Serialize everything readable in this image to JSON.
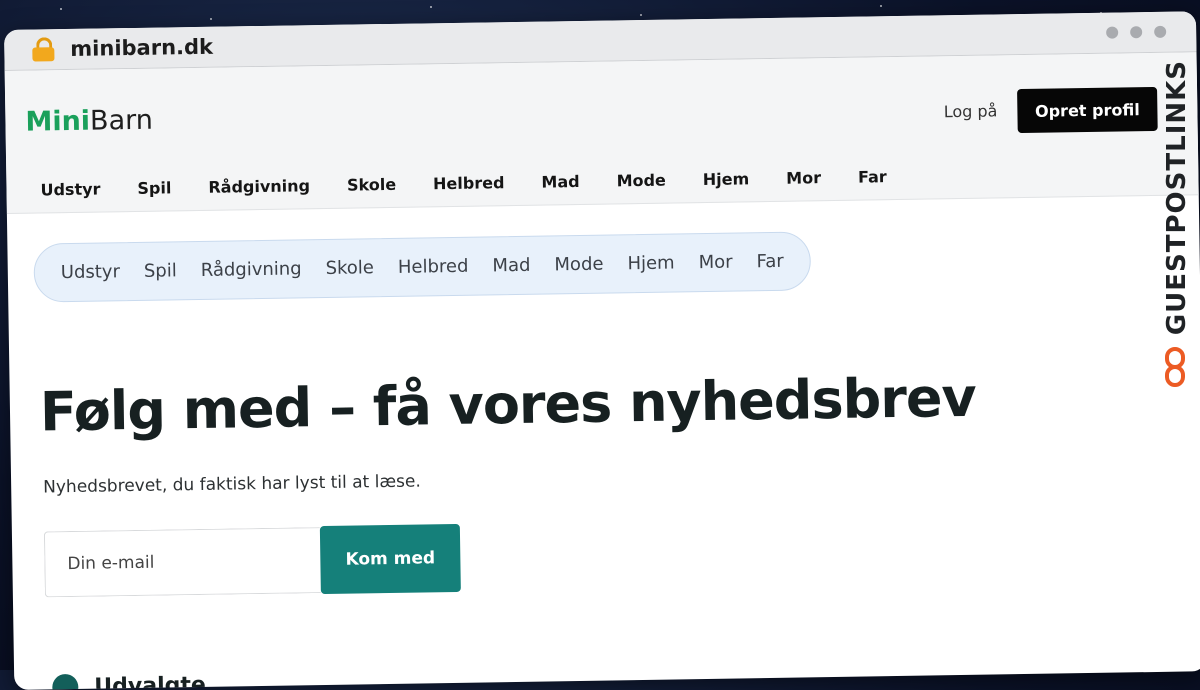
{
  "browser": {
    "url": "minibarn.dk"
  },
  "header": {
    "logo_primary": "Mini",
    "logo_secondary": "Barn",
    "login_label": "Log på",
    "signup_label": "Opret profil"
  },
  "main_nav": {
    "items": [
      "Udstyr",
      "Spil",
      "Rådgivning",
      "Skole",
      "Helbred",
      "Mad",
      "Mode",
      "Hjem",
      "Mor",
      "Far"
    ]
  },
  "pill_nav": {
    "items": [
      "Udstyr",
      "Spil",
      "Rådgivning",
      "Skole",
      "Helbred",
      "Mad",
      "Mode",
      "Hjem",
      "Mor",
      "Far"
    ]
  },
  "newsletter": {
    "headline": "Følg med – få vores nyhedsbrev",
    "subtext": "Nyhedsbrevet, du faktisk har lyst til at læse.",
    "email_placeholder": "Din e-mail",
    "submit_label": "Kom med"
  },
  "section": {
    "title": "Udvalgte"
  },
  "watermark": {
    "text": "GUESTPOSTLINKS"
  },
  "colors": {
    "brand_green": "#1aa05b",
    "button_teal": "#15807a",
    "watermark_orange": "#ec5b24"
  }
}
